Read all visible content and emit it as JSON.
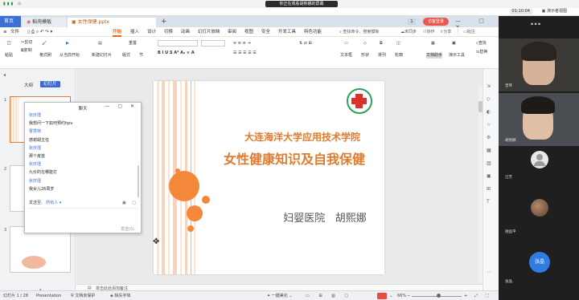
{
  "meeting": {
    "share_banner": "你正在观看胡熙娜的屏幕",
    "clock": "01:10:04",
    "record_label": "▣ 演示者视图"
  },
  "wps": {
    "tabs": {
      "home": "首页",
      "templates": "稻壳模板",
      "file": "女性保健.pptx",
      "count_badge": "1",
      "login": "访客登录"
    },
    "menu": {
      "file": "文件",
      "start": "开始",
      "insert": "插入",
      "design": "设计",
      "transitions": "切换",
      "animation": "动画",
      "slideshow": "幻灯片放映",
      "review": "审阅",
      "view": "视图",
      "security": "安全",
      "developer": "开发工具",
      "special": "特色功能",
      "search": "查找命令、搜索模板",
      "unsynced": "未同步",
      "collab": "协作",
      "share": "分享",
      "comment": "批注"
    },
    "ribbon": {
      "cut": "剪切",
      "copy": "复制",
      "paste": "粘贴",
      "format_painter": "格式刷",
      "from_current": "从当前开始",
      "new_slide": "新建幻灯片",
      "layout": "版式",
      "section": "节",
      "reset": "重置",
      "textbox": "文本框",
      "shape": "形状",
      "arrange": "排列",
      "outline": "轮廓",
      "text_assistant": "文档助手",
      "presenter_tools": "演示工具",
      "find": "查找",
      "replace": "替换"
    },
    "panel": {
      "outline_tab": "大纲",
      "slides_tab": "幻灯片",
      "add": "+",
      "thumb_numbers": [
        "1",
        "2",
        "3"
      ]
    },
    "slide": {
      "university": "大连海洋大学应用技术学院",
      "title": "女性健康知识及自我保健",
      "presenter": "妇婴医院   胡熙娜"
    },
    "notes_placeholder": "单击此处添加备注",
    "status": {
      "slide_count": "幻灯片 1 / 28",
      "theme": "Presentation",
      "protect": "文档未保护",
      "font_missing": "缺失字体",
      "beautify": "一键美化",
      "zoom": "66%"
    }
  },
  "chat": {
    "title": "聊天",
    "messages": [
      {
        "kind": "name",
        "text": "张庆瑾"
      },
      {
        "kind": "text",
        "text": "我想问一下如何预约hpv"
      },
      {
        "kind": "name",
        "text": "曹慧荷"
      },
      {
        "kind": "text",
        "text": "感谢胡主任"
      },
      {
        "kind": "name",
        "text": "张庆瑾"
      },
      {
        "kind": "text",
        "text": "那个疫苗"
      },
      {
        "kind": "name",
        "text": "张庆瑾"
      },
      {
        "kind": "text",
        "text": "九价的在哪能打"
      },
      {
        "kind": "name",
        "text": "张庆瑾"
      },
      {
        "kind": "text",
        "text": "我女儿26周岁"
      }
    ],
    "send_to_label": "发送至:",
    "recipient": "所有人 ▾",
    "send_button": "发送(S)"
  },
  "participants": [
    {
      "name": "曾琴"
    },
    {
      "name": "胡熙娜"
    },
    {
      "name": "汪芳"
    },
    {
      "name": "德固平"
    },
    {
      "name": "张晶",
      "initials": "张晶"
    }
  ],
  "colors": {
    "accent_orange": "#f08a3c",
    "title_orange": "#e07b2e",
    "wps_blue": "#3a6fd8",
    "login_red": "#e85a4f",
    "chat_name_blue": "#2f73d8"
  }
}
